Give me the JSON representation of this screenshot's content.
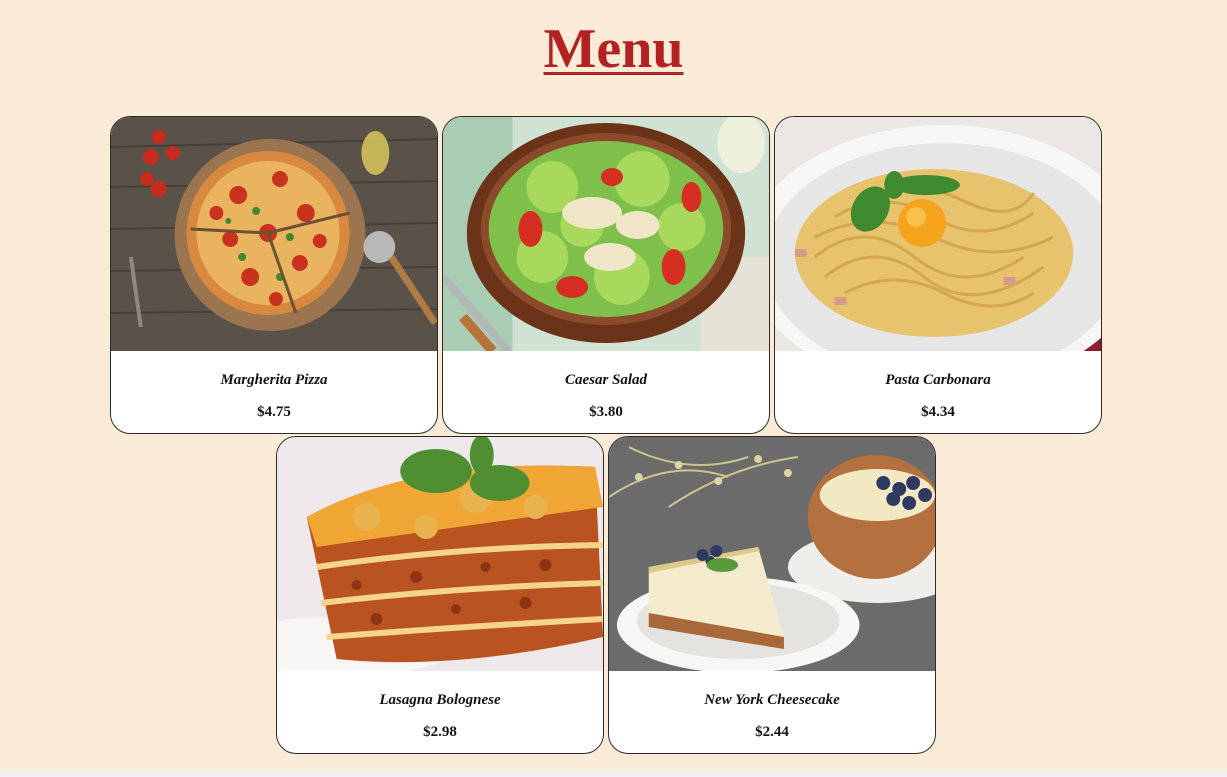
{
  "title": "Menu",
  "colors": {
    "background": "#faebd7",
    "title": "#b22222",
    "card": "#ffffff",
    "card_border": "#2b2b2b"
  },
  "items": [
    {
      "name": "Margherita Pizza",
      "price": "$4.75",
      "image": "pizza-photo"
    },
    {
      "name": "Caesar Salad",
      "price": "$3.80",
      "image": "salad-photo"
    },
    {
      "name": "Pasta Carbonara",
      "price": "$4.34",
      "image": "pasta-photo"
    },
    {
      "name": "Lasagna Bolognese",
      "price": "$2.98",
      "image": "lasagna-photo"
    },
    {
      "name": "New York Cheesecake",
      "price": "$2.44",
      "image": "cheesecake-photo"
    }
  ]
}
